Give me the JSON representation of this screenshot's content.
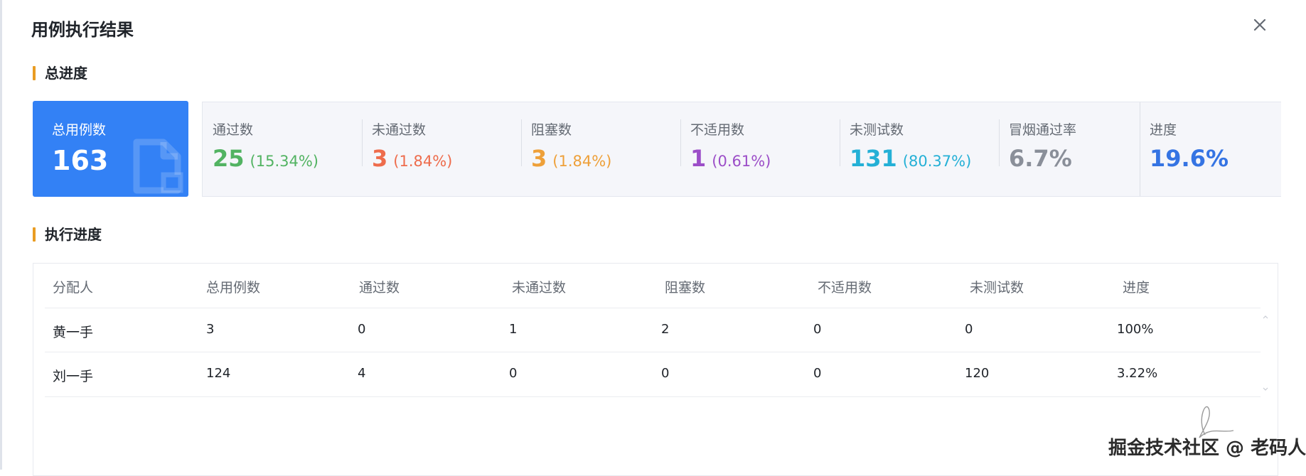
{
  "dialog": {
    "title": "用例执行结果"
  },
  "sections": {
    "overall": "总进度",
    "execution": "执行进度"
  },
  "total": {
    "label": "总用例数",
    "value": "163"
  },
  "stats": [
    {
      "label": "通过数",
      "value": "25",
      "pct": "(15.34%)",
      "color": "#52b362"
    },
    {
      "label": "未通过数",
      "value": "3",
      "pct": "(1.84%)",
      "color": "#ee6c4c"
    },
    {
      "label": "阻塞数",
      "value": "3",
      "pct": "(1.84%)",
      "color": "#eea039"
    },
    {
      "label": "不适用数",
      "value": "1",
      "pct": "(0.61%)",
      "color": "#9c4ec8"
    },
    {
      "label": "未测试数",
      "value": "131",
      "pct": "(80.37%)",
      "color": "#24b0d6"
    },
    {
      "label": "冒烟通过率",
      "value": "6.7%",
      "pct": "",
      "color": "#8a8f99"
    },
    {
      "label": "进度",
      "value": "19.6%",
      "pct": "",
      "color": "#3574e3"
    }
  ],
  "table": {
    "headers": [
      "分配人",
      "总用例数",
      "通过数",
      "未通过数",
      "阻塞数",
      "不适用数",
      "未测试数",
      "进度"
    ],
    "rows": [
      [
        "黄一手",
        "3",
        "0",
        "1",
        "2",
        "0",
        "0",
        "100%"
      ],
      [
        "刘一手",
        "124",
        "4",
        "0",
        "0",
        "0",
        "120",
        "3.22%"
      ]
    ]
  },
  "watermark": "掘金技术社区 @ 老码人",
  "colors": {
    "accent": "#3381f5",
    "section_bar": "#e99c23"
  },
  "icons": {
    "close": "close-icon",
    "total_card": "document-icon"
  }
}
